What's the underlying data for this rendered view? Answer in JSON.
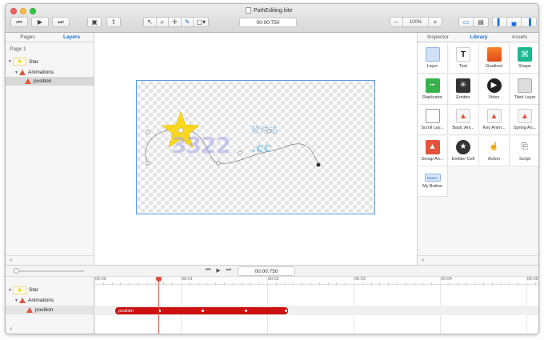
{
  "window": {
    "title": "PathEditing.kite"
  },
  "toolbar": {
    "rewind_icon": "rewind-icon",
    "play_icon": "play-icon",
    "forward_icon": "fast-forward-icon",
    "time": "00:00:750",
    "zoom": "100%",
    "zoom_out": "−",
    "zoom_in": "+"
  },
  "left_panel": {
    "tabs": [
      "Pages",
      "Layers"
    ],
    "selected_tab": "Layers",
    "page_label": "Page 1",
    "tree": [
      {
        "label": "Star",
        "depth": 0,
        "type": "layer"
      },
      {
        "label": "Animations",
        "depth": 1,
        "type": "animations"
      },
      {
        "label": "position",
        "depth": 2,
        "type": "animation",
        "selected": true
      }
    ]
  },
  "right_panel": {
    "tabs": [
      "Inspector",
      "Library",
      "Assets"
    ],
    "selected_tab": "Library",
    "items": [
      {
        "label": "Layer",
        "icon": "layer-icon"
      },
      {
        "label": "Text",
        "icon": "text-icon"
      },
      {
        "label": "Gradient",
        "icon": "gradient-icon"
      },
      {
        "label": "Shape",
        "icon": "shape-icon"
      },
      {
        "label": "Replicator",
        "icon": "replicator-icon"
      },
      {
        "label": "Emitter",
        "icon": "emitter-icon"
      },
      {
        "label": "Video",
        "icon": "video-icon"
      },
      {
        "label": "Tiled Layer",
        "icon": "tiled-layer-icon"
      },
      {
        "label": "Scroll Lay...",
        "icon": "scroll-layer-icon"
      },
      {
        "label": "Basic Ani...",
        "icon": "basic-animation-icon"
      },
      {
        "label": "Key Anim...",
        "icon": "key-animation-icon"
      },
      {
        "label": "Spring An...",
        "icon": "spring-animation-icon"
      },
      {
        "label": "Group An...",
        "icon": "group-animation-icon"
      },
      {
        "label": "Emitter Cell",
        "icon": "emitter-cell-icon"
      },
      {
        "label": "Action",
        "icon": "action-icon"
      },
      {
        "label": "Script",
        "icon": "script-icon"
      },
      {
        "label": "My Button",
        "icon": "button-icon",
        "icon_text": "Button"
      }
    ]
  },
  "watermark": {
    "number": "3322",
    "suffix": ".cc",
    "cn": "软件站"
  },
  "timeline": {
    "time": "00:00:750",
    "ruler": [
      "00:00",
      "00:01",
      "00:02",
      "00:03",
      "00:04",
      "00:05"
    ],
    "tree": [
      {
        "label": "Star",
        "depth": 0
      },
      {
        "label": "Animations",
        "depth": 1
      },
      {
        "label": "position",
        "depth": 2
      }
    ],
    "track_label": "position"
  },
  "colors": {
    "accent": "#1a6fe0",
    "track": "#cc1111",
    "playhead": "#e8493c"
  }
}
